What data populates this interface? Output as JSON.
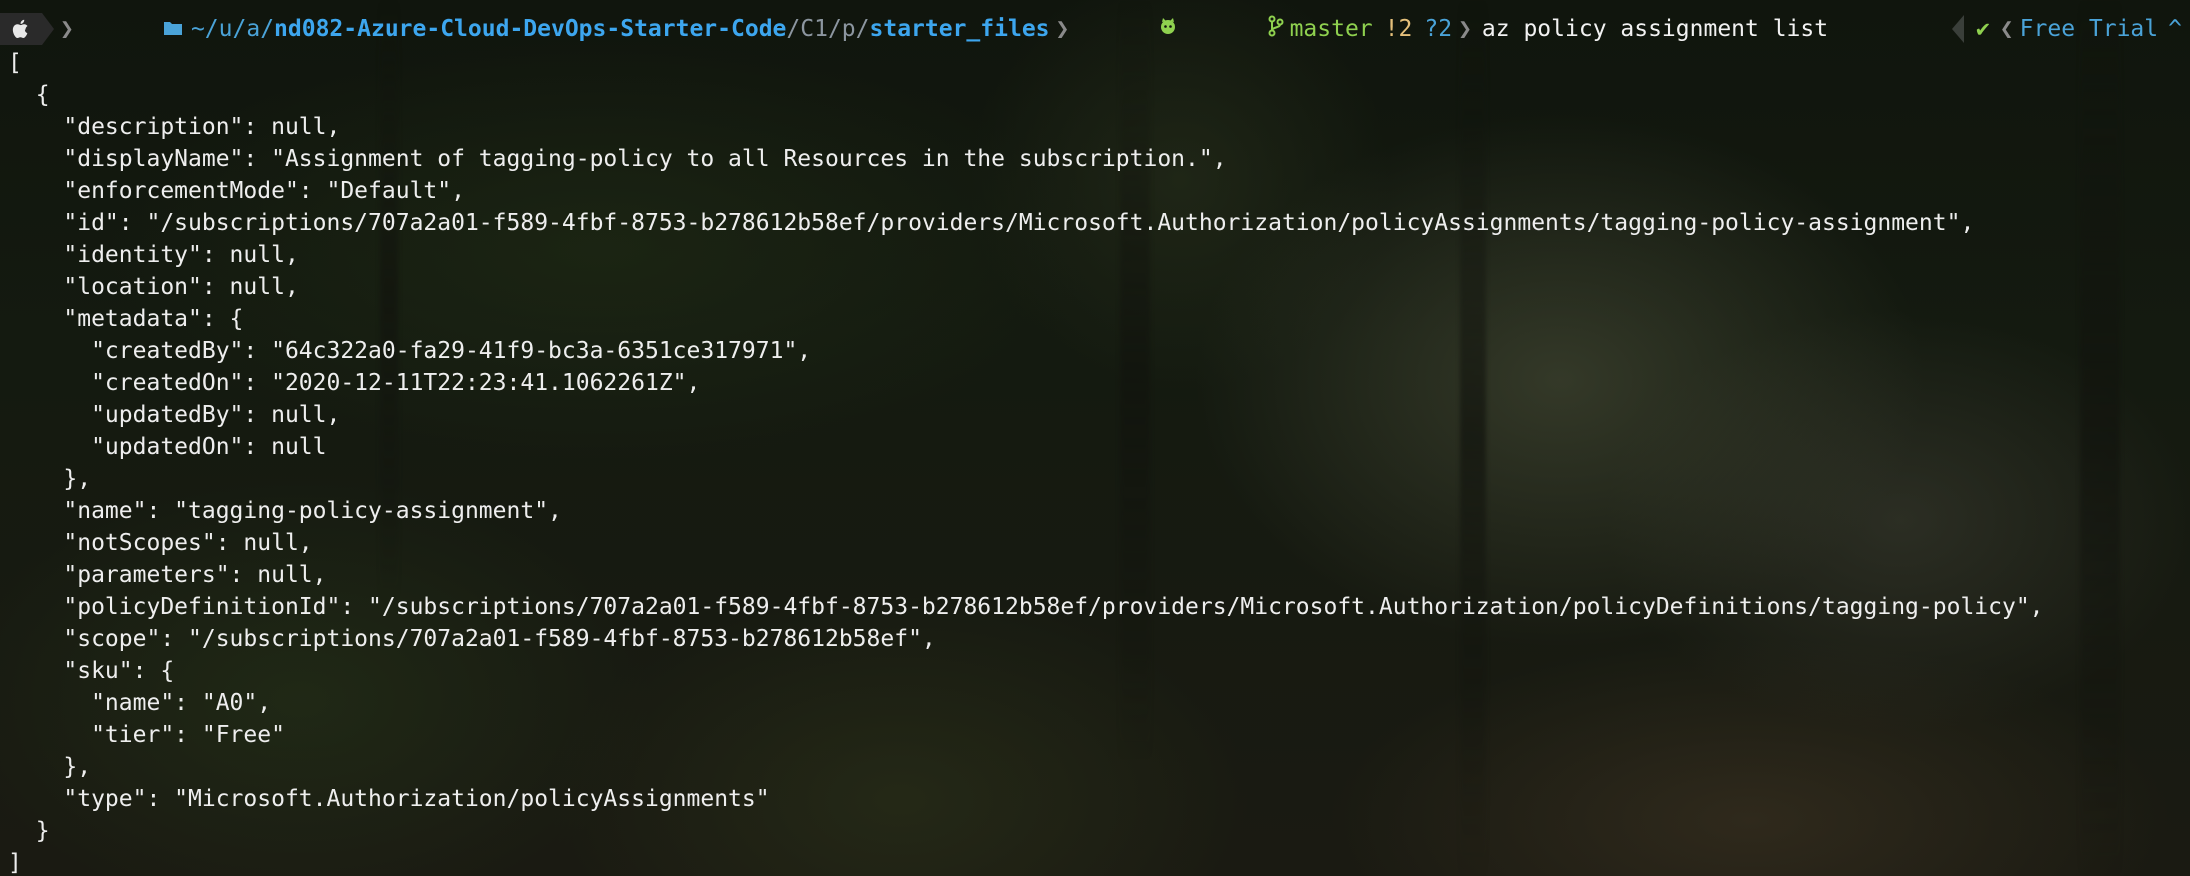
{
  "prompt": {
    "apple_icon": "apple-icon",
    "folder_icon": "folder-icon",
    "path_segments": [
      {
        "text": "~/u/a/",
        "style": "dim"
      },
      {
        "text": "nd082-Azure-Cloud-DevOps-Starter-Code",
        "style": "bold"
      },
      {
        "text": "/C1/p/",
        "style": "grey"
      },
      {
        "text": "starter_files",
        "style": "bold"
      }
    ],
    "git_icon": "github-icon",
    "branch_icon": "branch-icon",
    "branch": "master",
    "modified": "!2",
    "untracked": "?2",
    "command": "az policy assignment list",
    "right_check": "✔",
    "right_label": "Free Trial",
    "right_caret": "^"
  },
  "output_lines": [
    "[",
    "  {",
    "    \"description\": null,",
    "    \"displayName\": \"Assignment of tagging-policy to all Resources in the subscription.\",",
    "    \"enforcementMode\": \"Default\",",
    "    \"id\": \"/subscriptions/707a2a01-f589-4fbf-8753-b278612b58ef/providers/Microsoft.Authorization/policyAssignments/tagging-policy-assignment\",",
    "    \"identity\": null,",
    "    \"location\": null,",
    "    \"metadata\": {",
    "      \"createdBy\": \"64c322a0-fa29-41f9-bc3a-6351ce317971\",",
    "      \"createdOn\": \"2020-12-11T22:23:41.1062261Z\",",
    "      \"updatedBy\": null,",
    "      \"updatedOn\": null",
    "    },",
    "    \"name\": \"tagging-policy-assignment\",",
    "    \"notScopes\": null,",
    "    \"parameters\": null,",
    "    \"policyDefinitionId\": \"/subscriptions/707a2a01-f589-4fbf-8753-b278612b58ef/providers/Microsoft.Authorization/policyDefinitions/tagging-policy\",",
    "    \"scope\": \"/subscriptions/707a2a01-f589-4fbf-8753-b278612b58ef\",",
    "    \"sku\": {",
    "      \"name\": \"A0\",",
    "      \"tier\": \"Free\"",
    "    },",
    "    \"type\": \"Microsoft.Authorization/policyAssignments\"",
    "  }",
    "]"
  ]
}
